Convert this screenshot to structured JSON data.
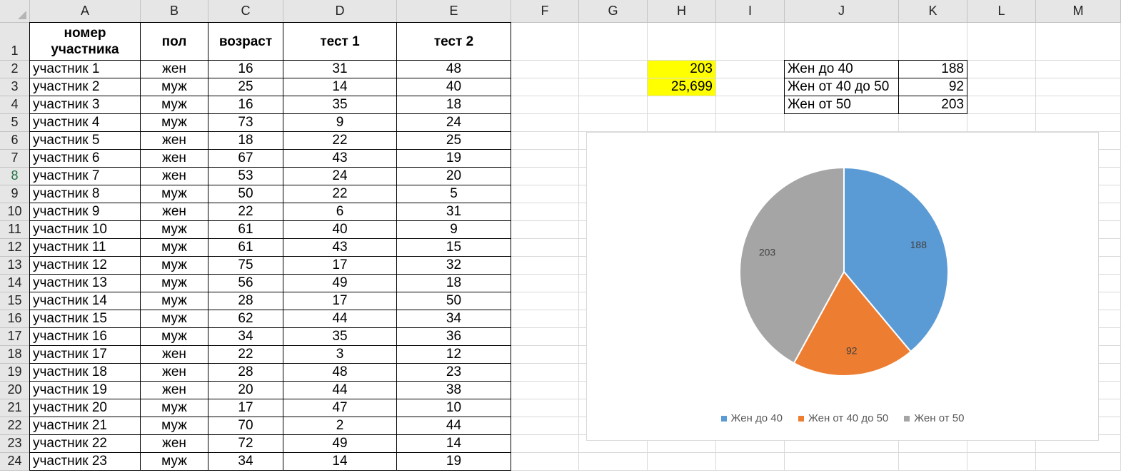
{
  "columns": [
    "A",
    "B",
    "C",
    "D",
    "E",
    "F",
    "G",
    "H",
    "I",
    "J",
    "K",
    "L",
    "M"
  ],
  "rows": [
    "1",
    "2",
    "3",
    "4",
    "5",
    "6",
    "7",
    "8",
    "9",
    "10",
    "11",
    "12",
    "13",
    "14",
    "15",
    "16",
    "17",
    "18",
    "19",
    "20",
    "21",
    "22",
    "23",
    "24"
  ],
  "selected_row": "8",
  "headers": {
    "participant": "номер участника",
    "sex": "пол",
    "age": "возраст",
    "test1": "тест 1",
    "test2": "тест 2"
  },
  "participants": [
    {
      "name": "участник 1",
      "sex": "жен",
      "age": "16",
      "test1": "31",
      "test2": "48"
    },
    {
      "name": "участник 2",
      "sex": "муж",
      "age": "25",
      "test1": "14",
      "test2": "40"
    },
    {
      "name": "участник 3",
      "sex": "муж",
      "age": "16",
      "test1": "35",
      "test2": "18"
    },
    {
      "name": "участник 4",
      "sex": "муж",
      "age": "73",
      "test1": "9",
      "test2": "24"
    },
    {
      "name": "участник 5",
      "sex": "жен",
      "age": "18",
      "test1": "22",
      "test2": "25"
    },
    {
      "name": "участник 6",
      "sex": "жен",
      "age": "67",
      "test1": "43",
      "test2": "19"
    },
    {
      "name": "участник 7",
      "sex": "жен",
      "age": "53",
      "test1": "24",
      "test2": "20"
    },
    {
      "name": "участник 8",
      "sex": "муж",
      "age": "50",
      "test1": "22",
      "test2": "5"
    },
    {
      "name": "участник 9",
      "sex": "жен",
      "age": "22",
      "test1": "6",
      "test2": "31"
    },
    {
      "name": "участник 10",
      "sex": "муж",
      "age": "61",
      "test1": "40",
      "test2": "9"
    },
    {
      "name": "участник 11",
      "sex": "муж",
      "age": "61",
      "test1": "43",
      "test2": "15"
    },
    {
      "name": "участник 12",
      "sex": "муж",
      "age": "75",
      "test1": "17",
      "test2": "32"
    },
    {
      "name": "участник 13",
      "sex": "муж",
      "age": "56",
      "test1": "49",
      "test2": "18"
    },
    {
      "name": "участник 14",
      "sex": "муж",
      "age": "28",
      "test1": "17",
      "test2": "50"
    },
    {
      "name": "участник 15",
      "sex": "муж",
      "age": "62",
      "test1": "44",
      "test2": "34"
    },
    {
      "name": "участник 16",
      "sex": "муж",
      "age": "34",
      "test1": "35",
      "test2": "36"
    },
    {
      "name": "участник 17",
      "sex": "жен",
      "age": "22",
      "test1": "3",
      "test2": "12"
    },
    {
      "name": "участник 18",
      "sex": "жен",
      "age": "28",
      "test1": "48",
      "test2": "23"
    },
    {
      "name": "участник 19",
      "sex": "жен",
      "age": "20",
      "test1": "44",
      "test2": "38"
    },
    {
      "name": "участник 20",
      "sex": "муж",
      "age": "17",
      "test1": "47",
      "test2": "10"
    },
    {
      "name": "участник 21",
      "sex": "муж",
      "age": "70",
      "test1": "2",
      "test2": "44"
    },
    {
      "name": "участник 22",
      "sex": "жен",
      "age": "72",
      "test1": "49",
      "test2": "14"
    },
    {
      "name": "участник 23",
      "sex": "муж",
      "age": "34",
      "test1": "14",
      "test2": "19"
    }
  ],
  "highlight": {
    "h2": "203",
    "h3": "25,699",
    "color": "#ffff00"
  },
  "summary": [
    {
      "label": "Жен до 40",
      "value": "188"
    },
    {
      "label": "Жен от 40 до 50",
      "value": "92"
    },
    {
      "label": "Жен от 50",
      "value": "203"
    }
  ],
  "chart_data": {
    "type": "pie",
    "categories": [
      "Жен до 40",
      "Жен от 40 до 50",
      "Жен от 50"
    ],
    "values": [
      188,
      92,
      203
    ],
    "colors": [
      "#5b9bd5",
      "#ed7d31",
      "#a5a5a5"
    ],
    "data_labels": [
      "188",
      "92",
      "203"
    ],
    "legend": "bottom"
  }
}
